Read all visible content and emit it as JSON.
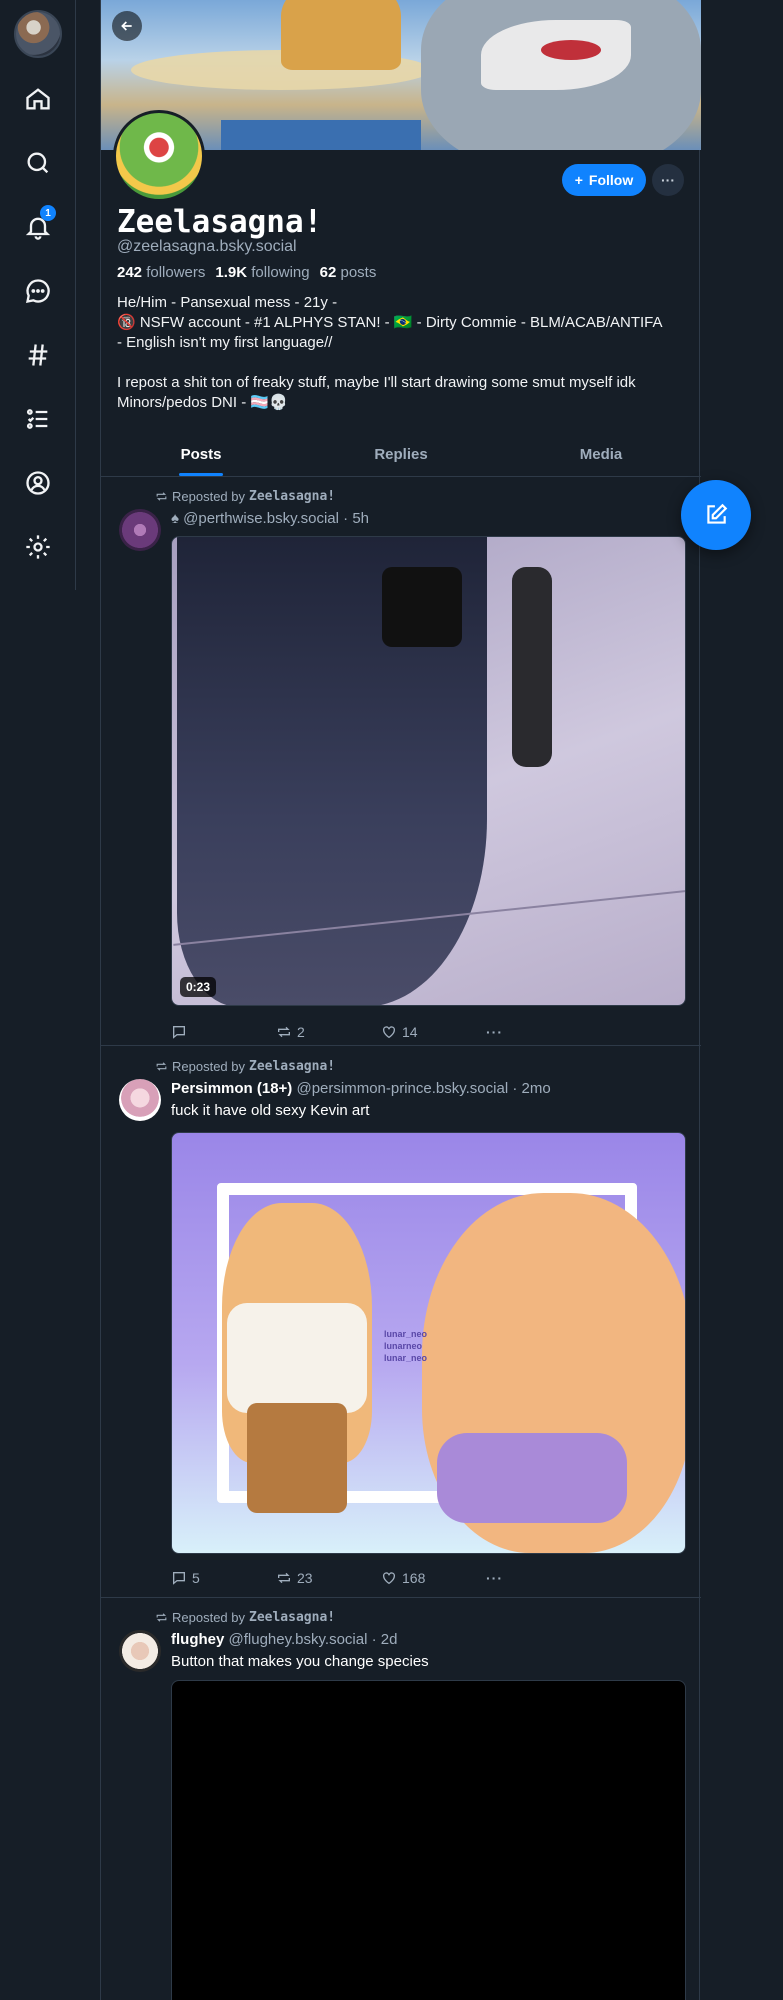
{
  "nav": {
    "notification_count": "1"
  },
  "profile": {
    "display_name": "Zeelasagna!",
    "handle": "@zeelasagna.bsky.social",
    "followers_count": "242",
    "followers_label": "followers",
    "following_count": "1.9K",
    "following_label": "following",
    "posts_count": "62",
    "posts_label": "posts",
    "follow_label": "Follow",
    "bio": [
      "He/Him - Pansexual mess - 21y -",
      "🔞 NSFW account - #1 ALPHYS STAN! - 🇧🇷 - Dirty Commie - BLM/ACAB/ANTIFA",
      "- English isn't my first language//",
      "",
      "I repost a shit ton of freaky stuff, maybe I'll start drawing some smut myself idk",
      "Minors/pedos DNI - 🏳️‍⚧️💀"
    ]
  },
  "tabs": [
    "Posts",
    "Replies",
    "Media"
  ],
  "posts": [
    {
      "repost_by_prefix": "Reposted by",
      "repost_by": "Zeelasagna!",
      "author": "",
      "handle": "♠ @perthwise.bsky.social",
      "time": "· 5h",
      "text": "",
      "duration": "0:23",
      "replies": "",
      "reposts": "2",
      "likes": "14"
    },
    {
      "repost_by_prefix": "Reposted by",
      "repost_by": "Zeelasagna!",
      "author": "Persimmon (18+)",
      "handle": "@persimmon-prince.bsky.social",
      "time": "· 2mo",
      "text": "fuck it have old sexy Kevin art",
      "replies": "5",
      "reposts": "23",
      "likes": "168",
      "watermark": [
        "lunar_neo",
        "lunarneo",
        "lunar_neo"
      ]
    },
    {
      "repost_by_prefix": "Reposted by",
      "repost_by": "Zeelasagna!",
      "author": "flughey",
      "handle": "@flughey.bsky.social",
      "time": "· 2d",
      "text": "Button that makes you change species"
    }
  ],
  "colors": {
    "background": "#161e27",
    "accent": "#1083fe",
    "muted": "#9fadbc",
    "border": "#2e3a48"
  }
}
